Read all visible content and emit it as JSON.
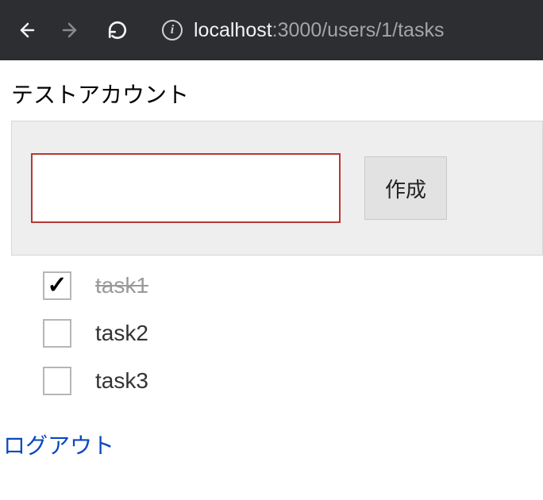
{
  "browser": {
    "url_host": "localhost",
    "url_path": ":3000/users/1/tasks"
  },
  "account": {
    "name": "テストアカウント"
  },
  "form": {
    "input_value": "",
    "create_label": "作成"
  },
  "tasks": [
    {
      "label": "task1",
      "done": true
    },
    {
      "label": "task2",
      "done": false
    },
    {
      "label": "task3",
      "done": false
    }
  ],
  "logout_label": "ログアウト",
  "icons": {
    "check": "✓"
  }
}
